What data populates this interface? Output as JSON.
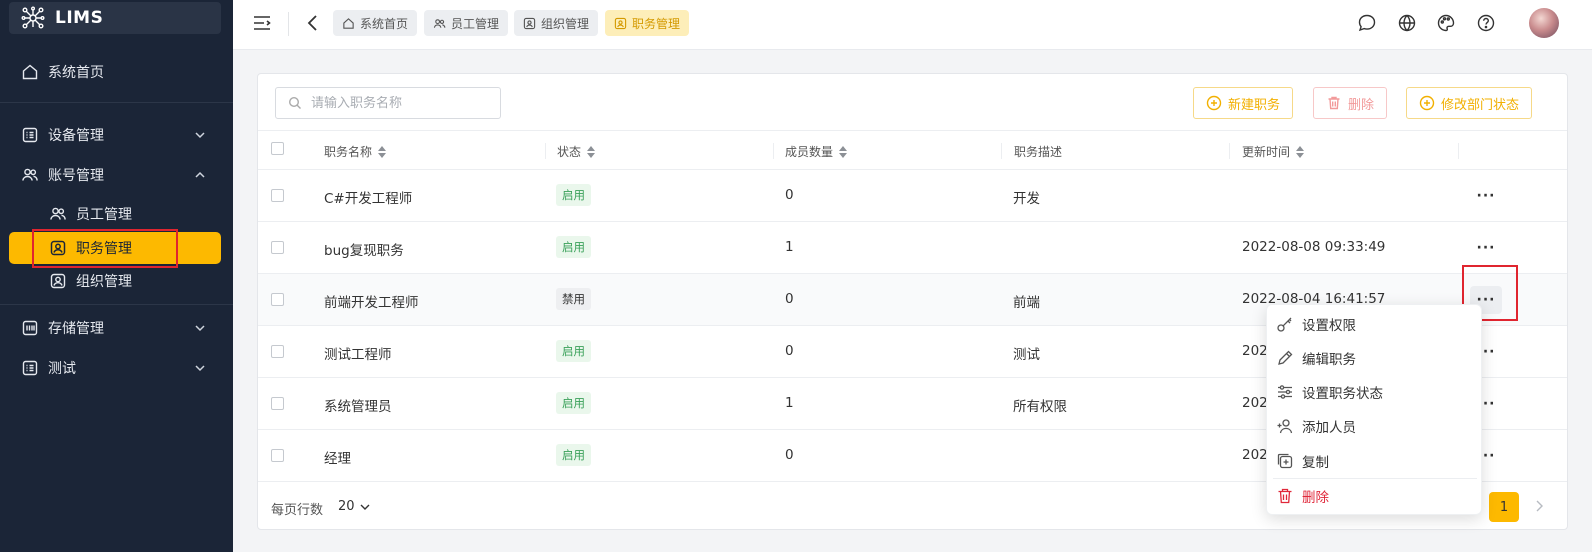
{
  "app": {
    "title": "LIMS"
  },
  "sidebar": {
    "home": "系统首页",
    "groups": [
      {
        "label": "设备管理",
        "expanded": false
      },
      {
        "label": "账号管理",
        "expanded": true,
        "children": [
          "员工管理",
          "职务管理",
          "组织管理"
        ]
      },
      {
        "label": "存储管理",
        "expanded": false
      },
      {
        "label": "测试",
        "expanded": false
      }
    ]
  },
  "header": {
    "breadcrumbs": [
      "系统首页",
      "员工管理",
      "组织管理",
      "职务管理"
    ],
    "active_breadcrumb": "职务管理"
  },
  "toolbar": {
    "search_placeholder": "请输入职务名称",
    "new_label": "新建职务",
    "delete_label": "删除",
    "change_status_label": "修改部门状态"
  },
  "table": {
    "columns": [
      "职务名称",
      "状态",
      "成员数量",
      "职务描述",
      "更新时间"
    ],
    "rows": [
      {
        "name": "C#开发工程师",
        "status": "启用",
        "members": "0",
        "desc": "开发",
        "updated": ""
      },
      {
        "name": "bug复现职务",
        "status": "启用",
        "members": "1",
        "desc": "",
        "updated": "2022-08-08 09:33:49"
      },
      {
        "name": "前端开发工程师",
        "status": "禁用",
        "members": "0",
        "desc": "前端",
        "updated": "2022-08-04 16:41:57"
      },
      {
        "name": "测试工程师",
        "status": "启用",
        "members": "0",
        "desc": "测试",
        "updated": "202"
      },
      {
        "name": "系统管理员",
        "status": "启用",
        "members": "1",
        "desc": "所有权限",
        "updated": "202"
      },
      {
        "name": "经理",
        "status": "启用",
        "members": "0",
        "desc": "",
        "updated": "202"
      }
    ],
    "more_label": "···"
  },
  "footer": {
    "rows_per_page_label": "每页行数",
    "rows_per_page": "20",
    "current_page": "1"
  },
  "menu": {
    "items": [
      "设置权限",
      "编辑职务",
      "设置职务状态",
      "添加人员",
      "复制"
    ],
    "danger_item": "删除"
  },
  "colors": {
    "accent": "#fdb900",
    "sidebar_bg": "#1b2537",
    "success": "#3aa15a",
    "danger": "#e0283a"
  }
}
